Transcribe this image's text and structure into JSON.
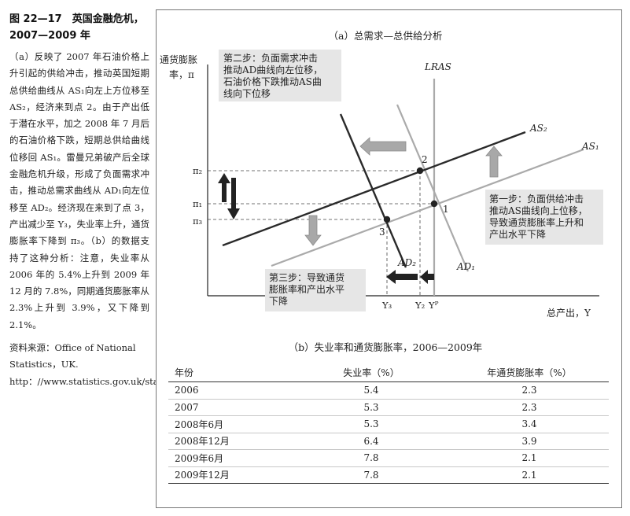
{
  "sidebar": {
    "title": "图 22—17　英国金融危机，2007—2009 年",
    "description": "（a）反映了 2007 年石油价格上升引起的供给冲击，推动英国短期总供给曲线从 AS₁向左上方位移至 AS₂，经济来到点 2。由于产出低于潜在水平，加之 2008 年 7 月后的石油价格下跌，短期总供给曲线位移回 AS₁。雷曼兄弟破产后全球金融危机升级，形成了负面需求冲击，推动总需求曲线从 AD₁向左位移至 AD₂。经济现在来到了点 3，产出减少至 Y₃，失业率上升，通货膨胀率下降到 π₃。（b）的数据支持了这种分析：注意，失业率从 2006 年的 5.4%上升到 2009 年 12 月的 7.8%，同期通货膨胀率从 2.3%上升到 3.9%，又下降到 2.1%。",
    "source": "资料来源：Office of National Statistics，UK. http：//www.statistics.gov.uk/statbase/tsdtimezone.asp."
  },
  "panel_a": {
    "title": "（a）总需求—总供给分析",
    "y_axis_label_line1": "通货膨胀",
    "y_axis_label_line2": "率，π",
    "x_axis_label": "总产出，Y",
    "curve_labels": {
      "lras": "LRAS",
      "as2": "AS₂",
      "as1": "AS₁",
      "ad1": "AD₁",
      "ad2": "AD₂"
    },
    "tick_labels": {
      "pi2": "π₂",
      "pi1": "π₁",
      "pi3": "π₃",
      "y3": "Y₃",
      "y2": "Y₂",
      "yp": "Yᴾ"
    },
    "points": {
      "p1": "1",
      "p2": "2",
      "p3": "3"
    },
    "step1": [
      "第一步：负面供给冲击",
      "推动AS曲线向上位移，",
      "导致通货膨胀率上升和",
      "产出水平下降"
    ],
    "step2": [
      "第二步：负面需求冲击",
      "推动AD曲线向左位移，",
      "石油价格下跌推动AS曲",
      "线向下位移"
    ],
    "step3": [
      "第三步：导致通货",
      "膨胀率和产出水平",
      "下降"
    ]
  },
  "panel_b": {
    "title": "（b）失业率和通货膨胀率，2006—2009年",
    "headers": [
      "年份",
      "失业率（%）",
      "年通货膨胀率（%）"
    ],
    "rows": [
      [
        "2006",
        "5.4",
        "2.3"
      ],
      [
        "2007",
        "5.3",
        "2.3"
      ],
      [
        "2008年6月",
        "5.3",
        "3.4"
      ],
      [
        "2008年12月",
        "6.4",
        "3.9"
      ],
      [
        "2009年6月",
        "7.8",
        "2.1"
      ],
      [
        "2009年12月",
        "7.8",
        "2.1"
      ]
    ]
  },
  "colors": {
    "curve_dark": "#2a2a2a",
    "curve_light": "#aaaaaa",
    "arrow_gray": "#a8a8a8",
    "box_gray": "#e6e6e6",
    "dash": "#444444"
  }
}
